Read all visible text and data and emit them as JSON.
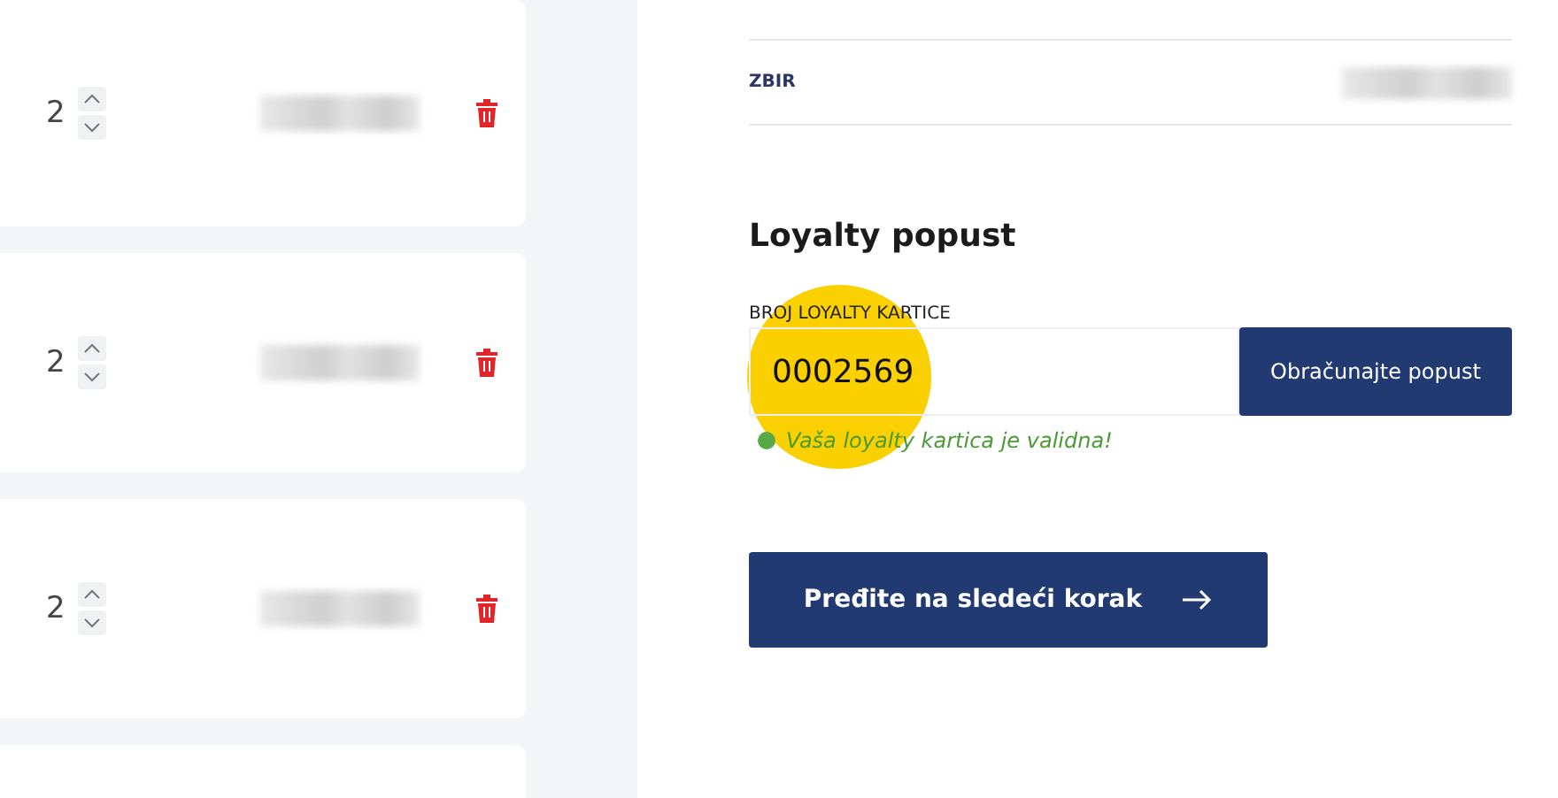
{
  "cart_items": [
    {
      "quantity": "2"
    },
    {
      "quantity": "2"
    },
    {
      "quantity": "2"
    }
  ],
  "summary": {
    "total_label": "ZBIR"
  },
  "loyalty": {
    "heading": "Loyalty popust",
    "field_label": "BROJ LOYALTY KARTICE",
    "value": "0002569",
    "apply_button": "Obračunajte popust",
    "message": "Vaša loyalty kartica je validna!",
    "valid": true
  },
  "next_button": {
    "label": "Pređite na sledeći korak"
  }
}
